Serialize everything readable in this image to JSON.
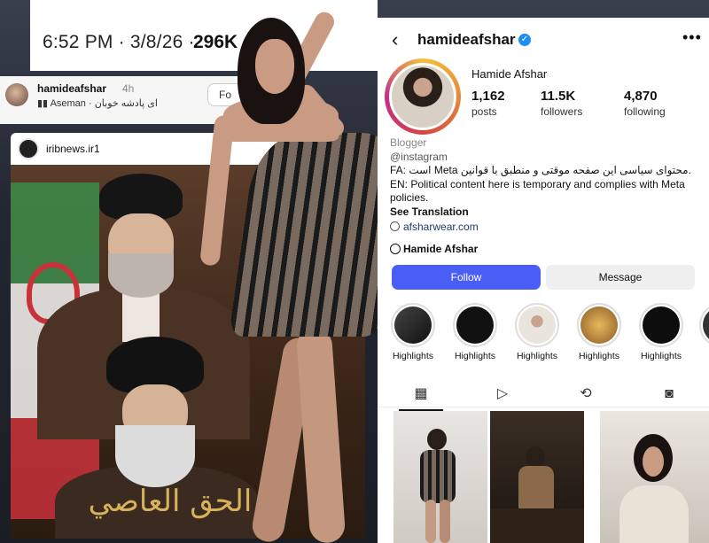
{
  "x_post": {
    "time": "6:52 PM · 3/8/26 ·",
    "views": "296K"
  },
  "threads_post": {
    "username": "hamideafshar",
    "age": "4h",
    "music": "Aseman · ای پادشه خوبان",
    "follow": "Fo"
  },
  "irib_post": {
    "username": "iribnews.ir1",
    "calligraphy": "الحق العاصي"
  },
  "instagram": {
    "handle": "hamideafshar",
    "display_name": "Hamide Afshar",
    "stats": [
      {
        "num": "1,162",
        "label": "posts"
      },
      {
        "num": "11.5K",
        "label": "followers"
      },
      {
        "num": "4,870",
        "label": "following"
      }
    ],
    "category": "Blogger",
    "mention": "@instagram",
    "bio_fa": "FA: است Meta محتوای سیاسی این صفحه موقتی و منطبق با قوانین.",
    "bio_en": "EN: Political content here is temporary and complies with Meta policies.",
    "see_translation": "See Translation",
    "link": "afsharwear.com",
    "threads_label": "Hamide Afshar",
    "follow_label": "Follow",
    "message_label": "Message",
    "highlights": [
      "Highlights",
      "Highlights",
      "Highlights",
      "Highlights",
      "Highlights",
      "H"
    ],
    "tab_icons": [
      "grid-icon",
      "reels-icon",
      "reposts-icon",
      "tagged-icon"
    ]
  },
  "colors": {
    "follow_blue": "#4a5df5",
    "verified_blue": "#1f8ef1"
  }
}
